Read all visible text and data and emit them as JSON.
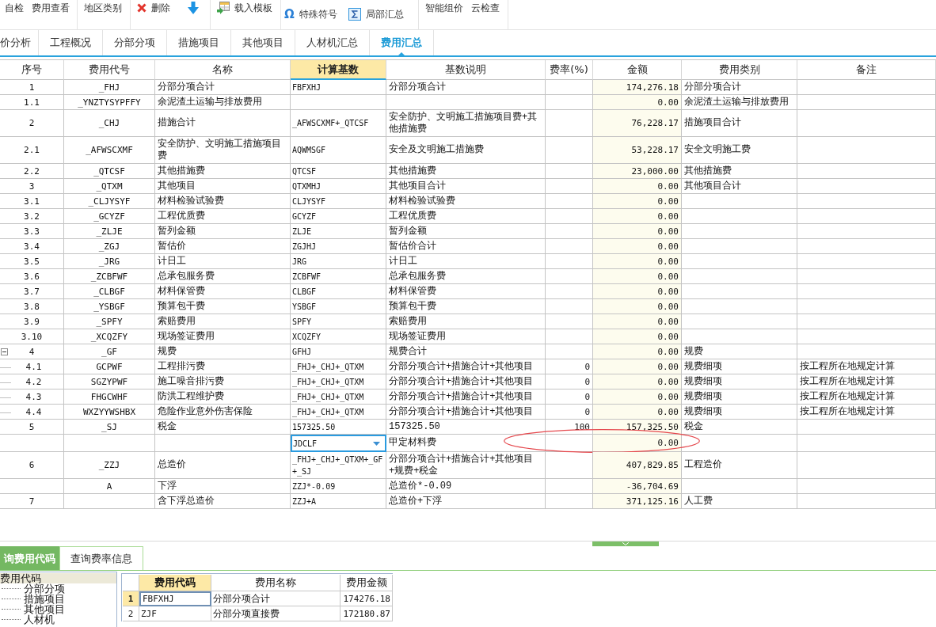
{
  "toolbar": {
    "groups": [
      {
        "kind": "inline",
        "items": [
          {
            "kind": "plain",
            "label": "自检"
          },
          {
            "kind": "plain",
            "label": "费用查看"
          }
        ]
      },
      {
        "kind": "inline",
        "items": [
          {
            "kind": "plain",
            "label": "地区类别"
          }
        ]
      },
      {
        "kind": "inline",
        "items": [
          {
            "kind": "delete",
            "label": "删除"
          },
          {
            "kind": "down"
          }
        ]
      },
      {
        "kind": "inline",
        "items": [
          {
            "kind": "template",
            "label": "载入模板"
          }
        ]
      },
      {
        "kind": "stacked",
        "items": [
          {
            "kind": "symbol",
            "glyph": "Ω",
            "label": "特殊符号"
          },
          {
            "kind": "summary",
            "label": "局部汇总"
          }
        ]
      },
      {
        "kind": "inline",
        "items": [
          {
            "kind": "plain",
            "label": "智能组价"
          },
          {
            "kind": "plain",
            "label": "云检查"
          }
        ]
      }
    ]
  },
  "tabs": [
    {
      "label": "价分析",
      "selected": false
    },
    {
      "label": "工程概况",
      "selected": false
    },
    {
      "label": "分部分项",
      "selected": false
    },
    {
      "label": "措施项目",
      "selected": false
    },
    {
      "label": "其他项目",
      "selected": false
    },
    {
      "label": "人材机汇总",
      "selected": false
    },
    {
      "label": "费用汇总",
      "selected": true
    }
  ],
  "table": {
    "columns": [
      {
        "label": "序号",
        "kind": "index",
        "selected": false,
        "shaded": false
      },
      {
        "label": "费用代号",
        "kind": "code",
        "selected": false,
        "shaded": false
      },
      {
        "label": "名称",
        "kind": "text",
        "selected": false,
        "shaded": false
      },
      {
        "label": "计算基数",
        "kind": "formula",
        "selected": true,
        "shaded": false
      },
      {
        "label": "基数说明",
        "kind": "text",
        "selected": false,
        "shaded": false
      },
      {
        "label": "费率(%)",
        "kind": "number",
        "selected": false,
        "shaded": false
      },
      {
        "label": "金额",
        "kind": "number",
        "selected": false,
        "shaded": true
      },
      {
        "label": "费用类别",
        "kind": "text",
        "selected": false,
        "shaded": false
      },
      {
        "label": "备注",
        "kind": "text",
        "selected": false,
        "shaded": false
      }
    ],
    "rows": [
      {
        "no": "1",
        "code": "_FHJ",
        "name": "分部分项合计",
        "base": "FBFXHJ",
        "base_desc": "分部分项合计",
        "amount": "174,276.18",
        "category": "分部分项合计",
        "editing": false,
        "circled": false
      },
      {
        "no": "1.1",
        "code": "_YNZTYSYPFFY",
        "name": "余泥渣土运输与排放费用",
        "amount": "0.00",
        "category": "余泥渣土运输与排放费用",
        "editing": false,
        "circled": false
      },
      {
        "no": "2",
        "code": "_CHJ",
        "name": "措施合计",
        "base": "_AFWSCXMF+_QTCSF",
        "base_desc": "安全防护、文明施工措施项目费+其他措施费",
        "amount": "76,228.17",
        "category": "措施项目合计",
        "editing": false,
        "circled": false
      },
      {
        "no": "2.1",
        "code": "_AFWSCXMF",
        "name": "安全防护、文明施工措施项目费",
        "base": "AQWMSGF",
        "base_desc": "安全及文明施工措施费",
        "amount": "53,228.17",
        "category": "安全文明施工费",
        "editing": false,
        "circled": false
      },
      {
        "no": "2.2",
        "code": "_QTCSF",
        "name": "其他措施费",
        "base": "QTCSF",
        "base_desc": "其他措施费",
        "amount": "23,000.00",
        "category": "其他措施费",
        "editing": false,
        "circled": false
      },
      {
        "no": "3",
        "code": "_QTXM",
        "name": "其他项目",
        "base": "QTXMHJ",
        "base_desc": "其他项目合计",
        "amount": "0.00",
        "category": "其他项目合计",
        "editing": false,
        "circled": false
      },
      {
        "no": "3.1",
        "code": "_CLJYSYF",
        "name": "材料检验试验费",
        "base": "CLJYSYF",
        "base_desc": "材料检验试验费",
        "amount": "0.00",
        "editing": false,
        "circled": false
      },
      {
        "no": "3.2",
        "code": "_GCYZF",
        "name": "工程优质费",
        "base": "GCYZF",
        "base_desc": "工程优质费",
        "amount": "0.00",
        "editing": false,
        "circled": false
      },
      {
        "no": "3.3",
        "code": "_ZLJE",
        "name": "暂列金额",
        "base": "ZLJE",
        "base_desc": "暂列金额",
        "amount": "0.00",
        "editing": false,
        "circled": false
      },
      {
        "no": "3.4",
        "code": "_ZGJ",
        "name": "暂估价",
        "base": "ZGJHJ",
        "base_desc": "暂估价合计",
        "amount": "0.00",
        "editing": false,
        "circled": false
      },
      {
        "no": "3.5",
        "code": "_JRG",
        "name": "计日工",
        "base": "JRG",
        "base_desc": "计日工",
        "amount": "0.00",
        "editing": false,
        "circled": false
      },
      {
        "no": "3.6",
        "code": "_ZCBFWF",
        "name": "总承包服务费",
        "base": "ZCBFWF",
        "base_desc": "总承包服务费",
        "amount": "0.00",
        "editing": false,
        "circled": false
      },
      {
        "no": "3.7",
        "code": "_CLBGF",
        "name": "材料保管费",
        "base": "CLBGF",
        "base_desc": "材料保管费",
        "amount": "0.00",
        "editing": false,
        "circled": false
      },
      {
        "no": "3.8",
        "code": "_YSBGF",
        "name": "预算包干费",
        "base": "YSBGF",
        "base_desc": "预算包干费",
        "amount": "0.00",
        "editing": false,
        "circled": false
      },
      {
        "no": "3.9",
        "code": "_SPFY",
        "name": "索赔费用",
        "base": "SPFY",
        "base_desc": "索赔费用",
        "amount": "0.00",
        "editing": false,
        "circled": false
      },
      {
        "no": "3.10",
        "code": "_XCQZFY",
        "name": "现场签证费用",
        "base": "XCQZFY",
        "base_desc": "现场签证费用",
        "amount": "0.00",
        "editing": false,
        "circled": false
      },
      {
        "no": "4",
        "code": "_GF",
        "name": "规费",
        "base": "GFHJ",
        "base_desc": "规费合计",
        "amount": "0.00",
        "category": "规费",
        "editing": false,
        "circled": false,
        "expanded": true,
        "children": [
          {
            "no": "4.1",
            "code": "GCPWF",
            "name": "工程排污费",
            "base": "_FHJ+_CHJ+_QTXM",
            "base_desc": "分部分项合计+措施合计+其他项目",
            "rate": "0",
            "amount": "0.00",
            "category": "规费细项",
            "note": "按工程所在地规定计算",
            "editing": false,
            "circled": false
          },
          {
            "no": "4.2",
            "code": "SGZYPWF",
            "name": "施工噪音排污费",
            "base": "_FHJ+_CHJ+_QTXM",
            "base_desc": "分部分项合计+措施合计+其他项目",
            "rate": "0",
            "amount": "0.00",
            "category": "规费细项",
            "note": "按工程所在地规定计算",
            "editing": false,
            "circled": false
          },
          {
            "no": "4.3",
            "code": "FHGCWHF",
            "name": "防洪工程维护费",
            "base": "_FHJ+_CHJ+_QTXM",
            "base_desc": "分部分项合计+措施合计+其他项目",
            "rate": "0",
            "amount": "0.00",
            "category": "规费细项",
            "note": "按工程所在地规定计算",
            "editing": false,
            "circled": false
          },
          {
            "no": "4.4",
            "code": "WXZYYWSHBX",
            "name": "危险作业意外伤害保险",
            "base": "_FHJ+_CHJ+_QTXM",
            "base_desc": "分部分项合计+措施合计+其他项目",
            "rate": "0",
            "amount": "0.00",
            "category": "规费细项",
            "note": "按工程所在地规定计算",
            "editing": false,
            "circled": false
          }
        ]
      },
      {
        "no": "5",
        "code": "_SJ",
        "name": "税金",
        "base": "157325.50",
        "base_desc": "157325.50",
        "rate": "100",
        "amount": "157,325.50",
        "category": "税金",
        "editing": false,
        "circled": false
      },
      {
        "base": "JDCLF",
        "base_desc": "甲定材料费",
        "amount": "0.00",
        "editing": true,
        "circled": true
      },
      {
        "no": "6",
        "code": "_ZZJ",
        "name": "总造价",
        "base": "_FHJ+_CHJ+_QTXM+_GF+_SJ",
        "base_desc": "分部分项合计+措施合计+其他项目+规费+税金",
        "amount": "407,829.85",
        "category": "工程造价",
        "editing": false,
        "circled": false
      },
      {
        "code": "A",
        "name": "下浮",
        "base": "ZZJ*-0.09",
        "base_desc": "总造价*-0.09",
        "amount": "-36,704.69",
        "editing": false,
        "circled": false
      },
      {
        "no": "7",
        "name": "含下浮总造价",
        "base": "ZZJ+A",
        "base_desc": "总造价+下浮",
        "amount": "371,125.16",
        "category": "人工费",
        "editing": false,
        "circled": false
      }
    ]
  },
  "bottom_tabs": [
    {
      "label": "询费用代码",
      "selected": true
    },
    {
      "label": "查询费率信息",
      "selected": false
    }
  ],
  "code_tree": {
    "label": "费用代码",
    "selected": true,
    "children": [
      {
        "label": "分部分项",
        "selected": false
      },
      {
        "label": "措施项目",
        "selected": false
      },
      {
        "label": "其他项目",
        "selected": false
      },
      {
        "label": "人材机",
        "selected": false
      }
    ]
  },
  "code_table": {
    "columns": [
      {
        "label": "费用代码",
        "selected": true
      },
      {
        "label": "费用名称",
        "selected": false
      },
      {
        "label": "费用金额",
        "selected": false
      }
    ],
    "rows": [
      {
        "no": "1",
        "code": "FBFXHJ",
        "name": "分部分项合计",
        "amount": "174276.18",
        "selected": true
      },
      {
        "no": "2",
        "code": "ZJF",
        "name": "分部分项直接费",
        "amount": "172180.87",
        "selected": false
      }
    ]
  }
}
